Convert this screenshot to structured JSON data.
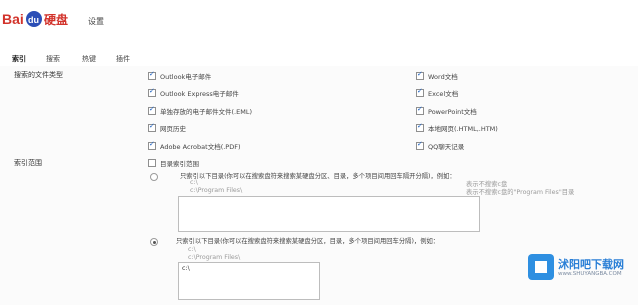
{
  "logo": {
    "latin": "Bai",
    "mark": "du",
    "chinese": "硬盘"
  },
  "window_title": "设置",
  "tabs": [
    {
      "label": "索引",
      "active": true
    },
    {
      "label": "搜索",
      "active": false
    },
    {
      "label": "热键",
      "active": false
    },
    {
      "label": "插件",
      "active": false
    }
  ],
  "file_types": {
    "label": "搜索的文件类型",
    "left": [
      "Outlook电子邮件",
      "Outlook Express电子邮件",
      "单独存放的电子邮件文件(.EML)",
      "网页历史",
      "Adobe Acrobat文档(.PDF)"
    ],
    "right": [
      "Word文档",
      "Excel文档",
      "PowerPoint文档",
      "本地网页(.HTML,.HTM)",
      "QQ聊天记录"
    ]
  },
  "index_scope": {
    "label": "索引范围",
    "checkbox_label": "目录索引范围",
    "option1": {
      "text": "只索引以下目录(你可以在搜索盘符来搜索某硬盘分区、目录，多个项目间用回车隔开分隔)，例如：",
      "example_path": "c:\\Program Files\\",
      "note1": "表示不搜索c盘",
      "note2": "表示不搜索c盘的\"Program Files\"目录",
      "prefix_line": "c:\\"
    },
    "option2": {
      "text": "只索引以下目录(你可以在搜索盘符来搜索某硬盘分区，目录，多个项目间用回车分隔)，例如：",
      "example_prefix": "c:\\",
      "example_path": "c:\\Program Files\\",
      "textarea_value": "c:\\"
    }
  },
  "watermark": {
    "name": "沭阳吧下载网",
    "url": "www.SHUYANGBA.COM"
  },
  "colors": {
    "accent": "#1b5fbf",
    "watermark_blue": "#2a7fd6",
    "logo_red": "#d2332b",
    "logo_blue": "#2b4eb6"
  }
}
